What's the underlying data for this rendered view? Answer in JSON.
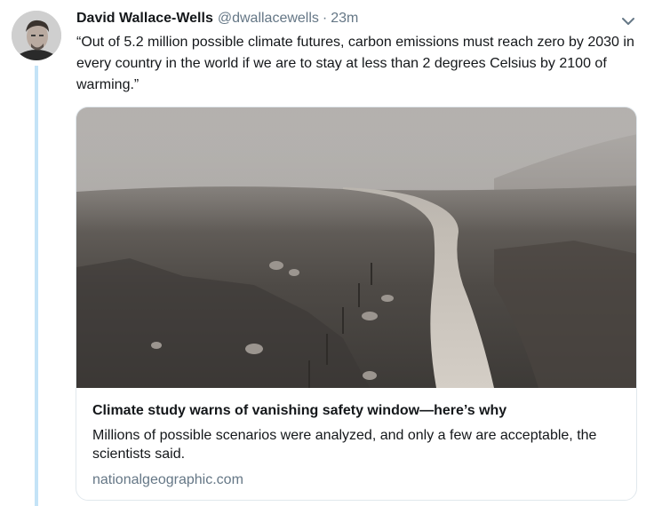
{
  "tweet": {
    "author_name": "David Wallace-Wells",
    "author_handle": "@dwallacewells",
    "separator": "·",
    "timestamp": "23m",
    "text": "“Out of 5.2 million possible climate futures, carbon emissions must reach zero by 2030 in every country in the world if we are to stay at less than 2 degrees Celsius by 2100 of warming.”",
    "menu_icon": "chevron-down-icon"
  },
  "card": {
    "title": "Climate study warns of vanishing safety window—here’s why",
    "description": "Millions of possible scenarios were analyzed, and only a few are acceptable, the scientists said.",
    "domain": "nationalgeographic.com",
    "image_subject": "dusty dirt road through burned landscape"
  },
  "colors": {
    "thread_line": "#c4e3f7",
    "secondary_text": "#657786",
    "border": "#e1e8ed"
  }
}
